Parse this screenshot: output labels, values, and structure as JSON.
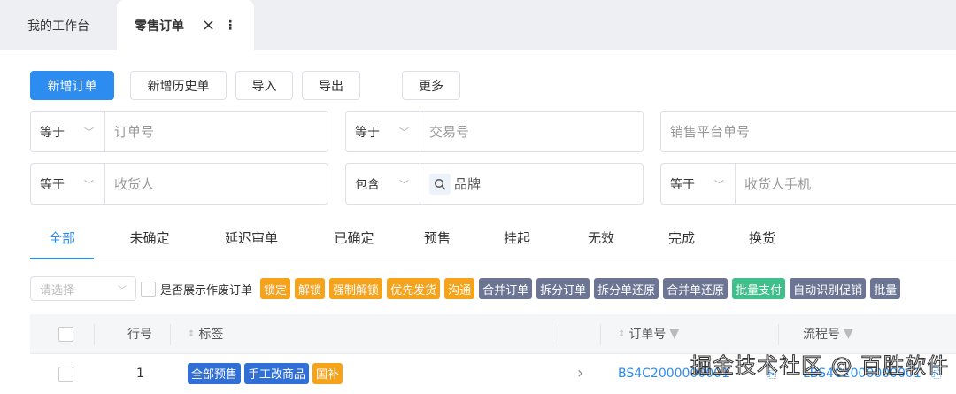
{
  "page_tabs": [
    {
      "label": "我的工作台"
    },
    {
      "label": "零售订单",
      "close": "×",
      "more": "⋮"
    }
  ],
  "actions": {
    "add": "新增订单",
    "add_history": "新增历史单",
    "import": "导入",
    "export": "导出",
    "more": "更多"
  },
  "filters": [
    {
      "op": "等于",
      "placeholder": "订单号"
    },
    {
      "op": "等于",
      "placeholder": "交易号"
    },
    {
      "op": "",
      "placeholder": "销售平台单号"
    },
    {
      "op": "等于",
      "placeholder": "收货人"
    },
    {
      "op": "包含",
      "placeholder": "品牌"
    },
    {
      "op": "等于",
      "placeholder": "收货人手机"
    }
  ],
  "status_tabs": [
    "全部",
    "未确定",
    "延迟审单",
    "已确定",
    "预售",
    "挂起",
    "无效",
    "完成",
    "换货"
  ],
  "toolbar": {
    "select_placeholder": "请选择",
    "show_void_label": "是否展示作废订单",
    "buttons": [
      {
        "label": "锁定",
        "color": "o"
      },
      {
        "label": "解锁",
        "color": "o"
      },
      {
        "label": "强制解锁",
        "color": "o"
      },
      {
        "label": "优先发货",
        "color": "o"
      },
      {
        "label": "沟通",
        "color": "o"
      },
      {
        "label": "合并订单",
        "color": "g"
      },
      {
        "label": "拆分订单",
        "color": "g"
      },
      {
        "label": "拆分单还原",
        "color": "g"
      },
      {
        "label": "合并单还原",
        "color": "g"
      },
      {
        "label": "批量支付",
        "color": "gr"
      },
      {
        "label": "自动识别促销",
        "color": "g"
      },
      {
        "label": "批量",
        "color": "g"
      }
    ]
  },
  "table": {
    "headers": {
      "row": "行号",
      "tags": "标签",
      "order_no": "订单号",
      "flow_no": "流程号"
    },
    "rows": [
      {
        "row": "1",
        "tags": [
          {
            "label": "全部预售",
            "color": "b"
          },
          {
            "label": "手工改商品",
            "color": "b"
          },
          {
            "label": "国补",
            "color": "o"
          }
        ],
        "order_no": "BS4C2000000001",
        "flow_no": "LBS4C2000000001"
      }
    ]
  },
  "watermark": "掘金技术社区 @ 百胜软件"
}
